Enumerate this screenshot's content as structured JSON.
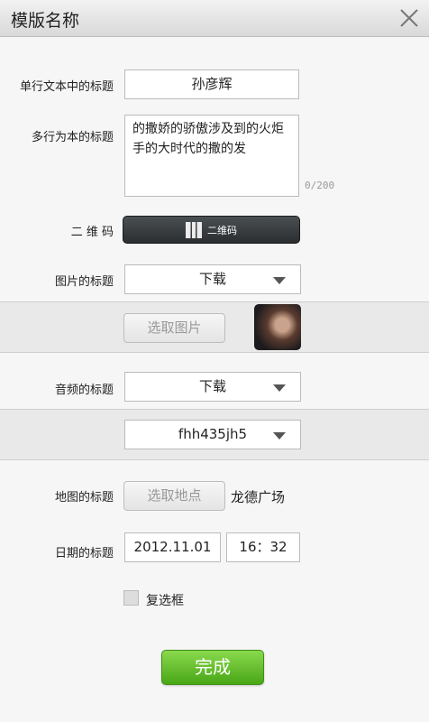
{
  "header": {
    "title": "模版名称"
  },
  "form": {
    "single_line": {
      "label": "单行文本中的标题",
      "value": "孙彦辉"
    },
    "multi_line": {
      "label": "多行为本的标题",
      "value": "的撒娇的骄傲涉及到的火炬手的大时代的撒的发",
      "counter": "0/200"
    },
    "qrcode": {
      "label": "二 维 码",
      "button_label": "二维码"
    },
    "image": {
      "label": "图片的标题",
      "selected": "下载",
      "pick_button": "选取图片"
    },
    "audio": {
      "label": "音频的标题",
      "selected": "下载",
      "second_selected": "fhh435jh5"
    },
    "map": {
      "label": "地图的标题",
      "pick_button": "选取地点",
      "location": "龙德广场"
    },
    "date": {
      "label": "日期的标题",
      "date": "2012.11.01",
      "time": "16：32"
    },
    "checkbox": {
      "label": "复选框",
      "checked": false
    }
  },
  "footer": {
    "done_label": "完成"
  },
  "colors": {
    "primary_button": "#48a716",
    "dark_button": "#2b2e30"
  },
  "icons": {
    "close": "close-icon",
    "qr": "qr-code-icon",
    "dropdown": "dropdown-arrow-icon"
  }
}
